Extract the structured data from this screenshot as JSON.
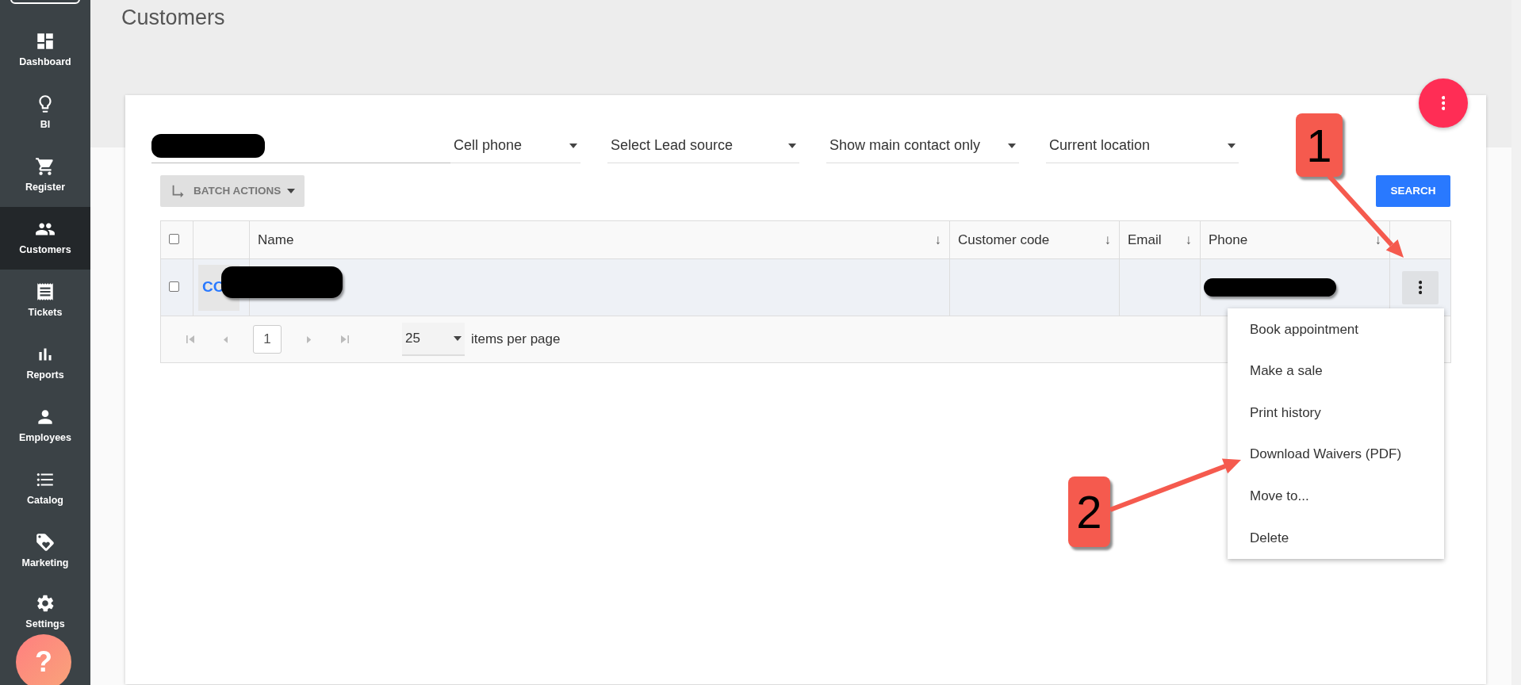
{
  "sidebar": {
    "items": [
      {
        "kind": "dashboard",
        "label": "Dashboard",
        "selected": false
      },
      {
        "kind": "bulb",
        "label": "BI",
        "selected": false
      },
      {
        "kind": "cart",
        "label": "Register",
        "selected": false
      },
      {
        "kind": "people",
        "label": "Customers",
        "selected": true
      },
      {
        "kind": "receipt",
        "label": "Tickets",
        "selected": false
      },
      {
        "kind": "chart",
        "label": "Reports",
        "selected": false
      },
      {
        "kind": "person",
        "label": "Employees",
        "selected": false
      },
      {
        "kind": "list",
        "label": "Catalog",
        "selected": false
      },
      {
        "kind": "tag",
        "label": "Marketing",
        "selected": false
      },
      {
        "kind": "gear",
        "label": "Settings",
        "selected": false
      }
    ]
  },
  "help_button": {
    "label": "?"
  },
  "page_title": "Customers",
  "filters": [
    {
      "value": "Cell phone"
    },
    {
      "value": "Select Lead source"
    },
    {
      "value": "Show main contact only"
    },
    {
      "value": "Current location"
    }
  ],
  "batch_actions": {
    "label": "BATCH ACTIONS"
  },
  "search_button": {
    "label": "SEARCH"
  },
  "table": {
    "select_all": {
      "checked": false
    },
    "columns": [
      {
        "label": "Name",
        "sort": "↓"
      },
      {
        "label": "Customer code",
        "sort": "↓"
      },
      {
        "label": "Email",
        "sort": "↓"
      },
      {
        "label": "Phone",
        "sort": "↓"
      }
    ],
    "rows": [
      {
        "checked": false,
        "avatar": "CO"
      }
    ]
  },
  "pager": {
    "page": "1",
    "page_size": "25",
    "suffix": "items per page"
  },
  "row_menu": {
    "items": [
      {
        "label": "Book appointment"
      },
      {
        "label": "Make a sale"
      },
      {
        "label": "Print history"
      },
      {
        "label": "Download Waivers (PDF)"
      },
      {
        "label": "Move to..."
      },
      {
        "label": "Delete"
      }
    ]
  },
  "callouts": [
    {
      "label": "1"
    },
    {
      "label": "2"
    }
  ]
}
